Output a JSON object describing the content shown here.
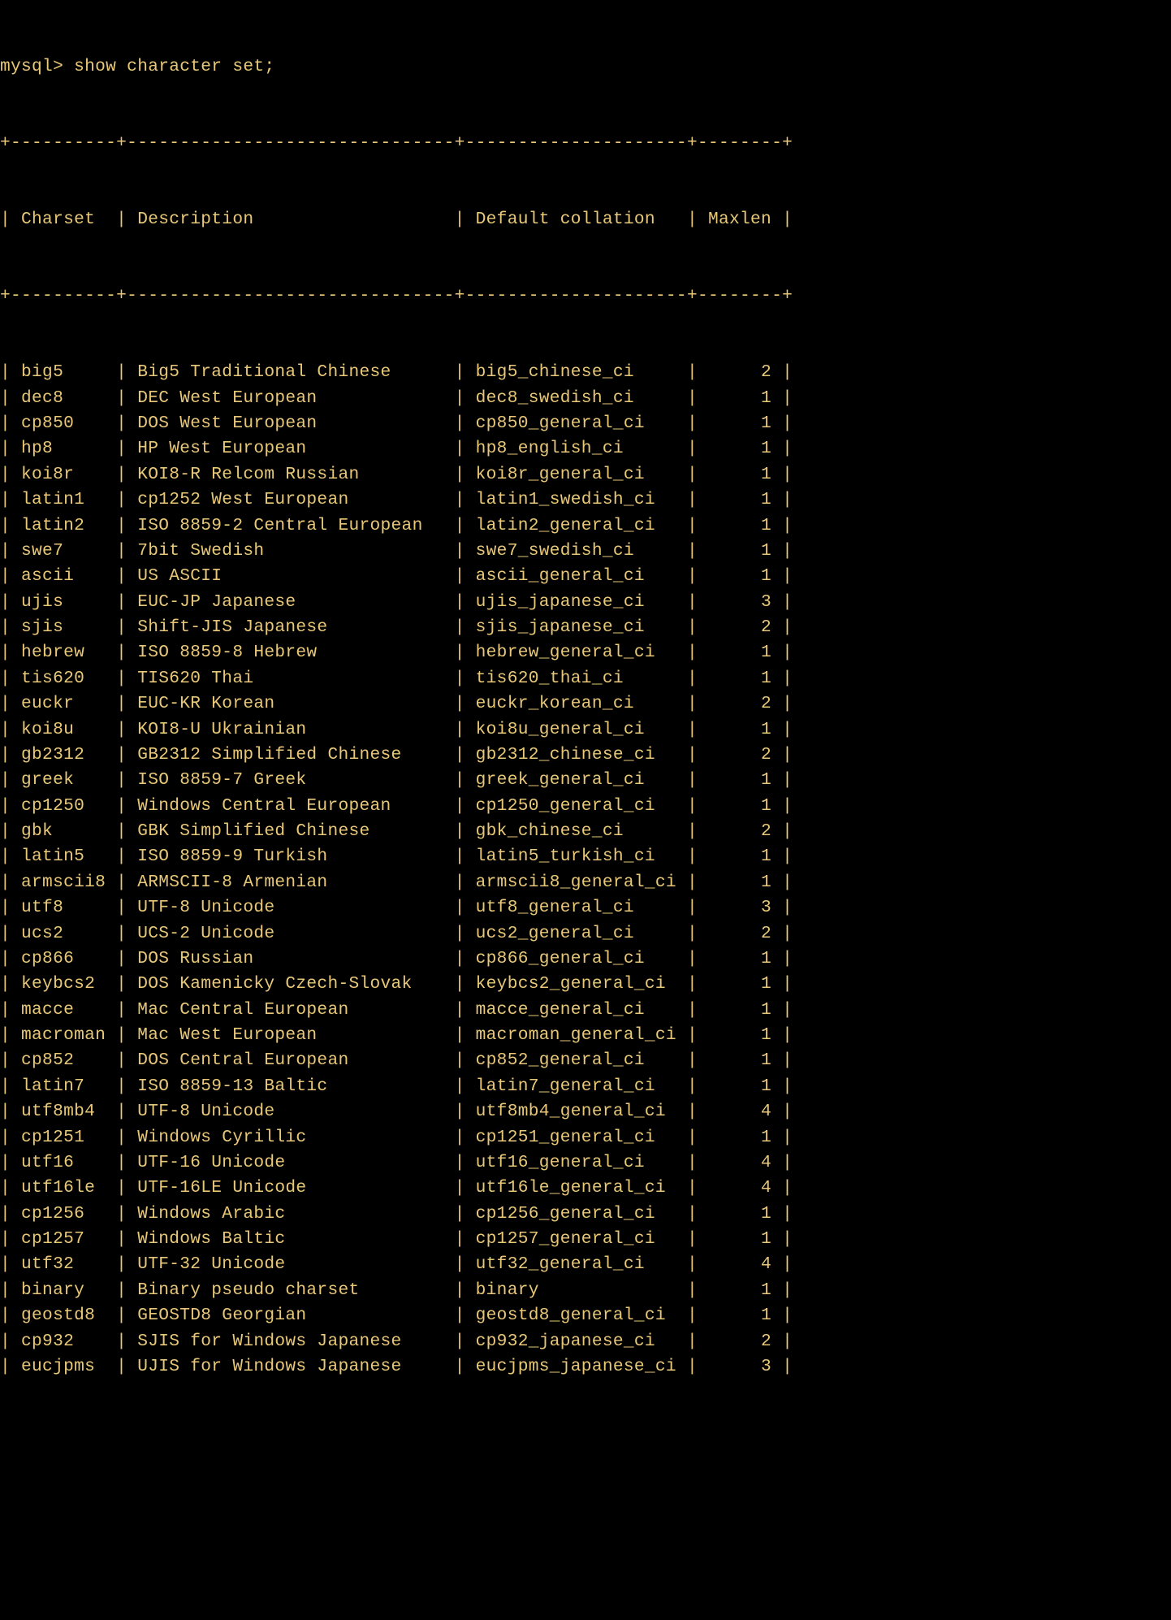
{
  "prompt": "mysql> ",
  "command": "show character set;",
  "columns": [
    "Charset",
    "Description",
    "Default collation",
    "Maxlen"
  ],
  "widths": [
    10,
    31,
    21,
    8
  ],
  "rows": [
    {
      "charset": "big5",
      "description": "Big5 Traditional Chinese",
      "collation": "big5_chinese_ci",
      "maxlen": 2
    },
    {
      "charset": "dec8",
      "description": "DEC West European",
      "collation": "dec8_swedish_ci",
      "maxlen": 1
    },
    {
      "charset": "cp850",
      "description": "DOS West European",
      "collation": "cp850_general_ci",
      "maxlen": 1
    },
    {
      "charset": "hp8",
      "description": "HP West European",
      "collation": "hp8_english_ci",
      "maxlen": 1
    },
    {
      "charset": "koi8r",
      "description": "KOI8-R Relcom Russian",
      "collation": "koi8r_general_ci",
      "maxlen": 1
    },
    {
      "charset": "latin1",
      "description": "cp1252 West European",
      "collation": "latin1_swedish_ci",
      "maxlen": 1
    },
    {
      "charset": "latin2",
      "description": "ISO 8859-2 Central European",
      "collation": "latin2_general_ci",
      "maxlen": 1
    },
    {
      "charset": "swe7",
      "description": "7bit Swedish",
      "collation": "swe7_swedish_ci",
      "maxlen": 1
    },
    {
      "charset": "ascii",
      "description": "US ASCII",
      "collation": "ascii_general_ci",
      "maxlen": 1
    },
    {
      "charset": "ujis",
      "description": "EUC-JP Japanese",
      "collation": "ujis_japanese_ci",
      "maxlen": 3
    },
    {
      "charset": "sjis",
      "description": "Shift-JIS Japanese",
      "collation": "sjis_japanese_ci",
      "maxlen": 2
    },
    {
      "charset": "hebrew",
      "description": "ISO 8859-8 Hebrew",
      "collation": "hebrew_general_ci",
      "maxlen": 1
    },
    {
      "charset": "tis620",
      "description": "TIS620 Thai",
      "collation": "tis620_thai_ci",
      "maxlen": 1
    },
    {
      "charset": "euckr",
      "description": "EUC-KR Korean",
      "collation": "euckr_korean_ci",
      "maxlen": 2
    },
    {
      "charset": "koi8u",
      "description": "KOI8-U Ukrainian",
      "collation": "koi8u_general_ci",
      "maxlen": 1
    },
    {
      "charset": "gb2312",
      "description": "GB2312 Simplified Chinese",
      "collation": "gb2312_chinese_ci",
      "maxlen": 2
    },
    {
      "charset": "greek",
      "description": "ISO 8859-7 Greek",
      "collation": "greek_general_ci",
      "maxlen": 1
    },
    {
      "charset": "cp1250",
      "description": "Windows Central European",
      "collation": "cp1250_general_ci",
      "maxlen": 1
    },
    {
      "charset": "gbk",
      "description": "GBK Simplified Chinese",
      "collation": "gbk_chinese_ci",
      "maxlen": 2
    },
    {
      "charset": "latin5",
      "description": "ISO 8859-9 Turkish",
      "collation": "latin5_turkish_ci",
      "maxlen": 1
    },
    {
      "charset": "armscii8",
      "description": "ARMSCII-8 Armenian",
      "collation": "armscii8_general_ci",
      "maxlen": 1
    },
    {
      "charset": "utf8",
      "description": "UTF-8 Unicode",
      "collation": "utf8_general_ci",
      "maxlen": 3
    },
    {
      "charset": "ucs2",
      "description": "UCS-2 Unicode",
      "collation": "ucs2_general_ci",
      "maxlen": 2
    },
    {
      "charset": "cp866",
      "description": "DOS Russian",
      "collation": "cp866_general_ci",
      "maxlen": 1
    },
    {
      "charset": "keybcs2",
      "description": "DOS Kamenicky Czech-Slovak",
      "collation": "keybcs2_general_ci",
      "maxlen": 1
    },
    {
      "charset": "macce",
      "description": "Mac Central European",
      "collation": "macce_general_ci",
      "maxlen": 1
    },
    {
      "charset": "macroman",
      "description": "Mac West European",
      "collation": "macroman_general_ci",
      "maxlen": 1
    },
    {
      "charset": "cp852",
      "description": "DOS Central European",
      "collation": "cp852_general_ci",
      "maxlen": 1
    },
    {
      "charset": "latin7",
      "description": "ISO 8859-13 Baltic",
      "collation": "latin7_general_ci",
      "maxlen": 1
    },
    {
      "charset": "utf8mb4",
      "description": "UTF-8 Unicode",
      "collation": "utf8mb4_general_ci",
      "maxlen": 4
    },
    {
      "charset": "cp1251",
      "description": "Windows Cyrillic",
      "collation": "cp1251_general_ci",
      "maxlen": 1
    },
    {
      "charset": "utf16",
      "description": "UTF-16 Unicode",
      "collation": "utf16_general_ci",
      "maxlen": 4
    },
    {
      "charset": "utf16le",
      "description": "UTF-16LE Unicode",
      "collation": "utf16le_general_ci",
      "maxlen": 4
    },
    {
      "charset": "cp1256",
      "description": "Windows Arabic",
      "collation": "cp1256_general_ci",
      "maxlen": 1
    },
    {
      "charset": "cp1257",
      "description": "Windows Baltic",
      "collation": "cp1257_general_ci",
      "maxlen": 1
    },
    {
      "charset": "utf32",
      "description": "UTF-32 Unicode",
      "collation": "utf32_general_ci",
      "maxlen": 4
    },
    {
      "charset": "binary",
      "description": "Binary pseudo charset",
      "collation": "binary",
      "maxlen": 1
    },
    {
      "charset": "geostd8",
      "description": "GEOSTD8 Georgian",
      "collation": "geostd8_general_ci",
      "maxlen": 1
    },
    {
      "charset": "cp932",
      "description": "SJIS for Windows Japanese",
      "collation": "cp932_japanese_ci",
      "maxlen": 2
    },
    {
      "charset": "eucjpms",
      "description": "UJIS for Windows Japanese",
      "collation": "eucjpms_japanese_ci",
      "maxlen": 3
    }
  ]
}
